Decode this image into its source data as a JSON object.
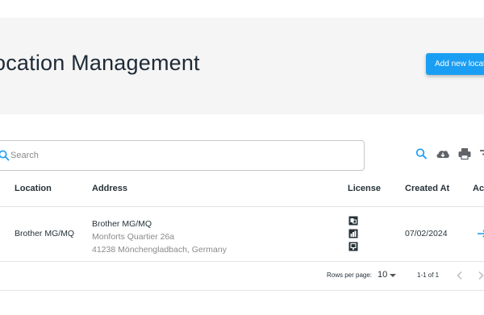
{
  "header": {
    "title": "ocation Management",
    "add_button_label": "Add new location"
  },
  "search": {
    "placeholder": "Search",
    "value": ""
  },
  "toolbar": {
    "icons": [
      "search-icon",
      "cloud-download-icon",
      "print-icon",
      "filter-icon"
    ],
    "accent_color": "#1a9ef3"
  },
  "table": {
    "columns": [
      "Location",
      "Address",
      "License",
      "Created At",
      "Act"
    ],
    "rows": [
      {
        "location": "Brother MG/MQ",
        "address_line1": "Brother MG/MQ",
        "address_line2": "Monforts Quartier 26a",
        "address_line3": "41238 Mönchengladbach, Germany",
        "license_icons": [
          "license-icon-1",
          "license-icon-2",
          "license-icon-3"
        ],
        "created_at": "07/02/2024"
      }
    ]
  },
  "pagination": {
    "rows_per_page_label": "Rows per page:",
    "rows_per_page_value": "10",
    "range_label": "1-1 of 1"
  }
}
